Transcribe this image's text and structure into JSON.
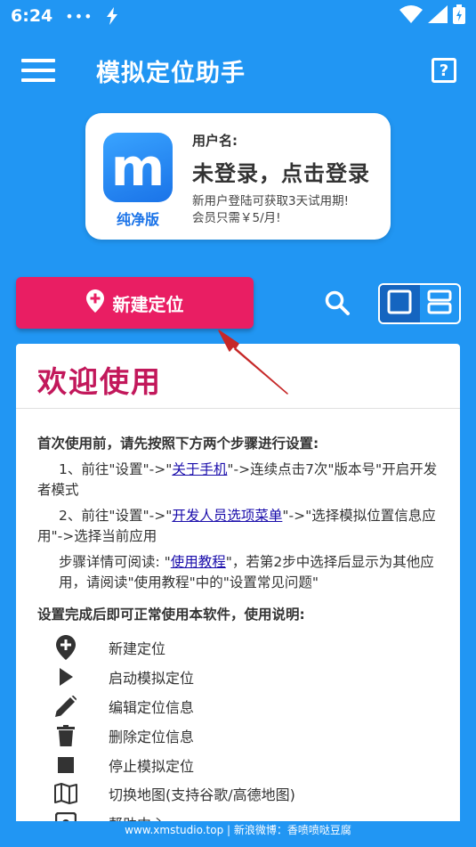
{
  "status_bar": {
    "time": "6:24",
    "dots": "•••"
  },
  "app_bar": {
    "title": "模拟定位助手",
    "help_glyph": "?"
  },
  "user_card": {
    "logo_glyph": "m",
    "logo_tag": "纯净版",
    "username_label": "用户名:",
    "login_text": "未登录，点击登录",
    "trial_line1": "新用户登陆可获取3天试用期!",
    "trial_line2": "会员只需￥5/月!"
  },
  "actions": {
    "new_location_label": "新建定位",
    "view_mode_selected": "grid"
  },
  "welcome": {
    "title": "欢迎使用",
    "intro": "首次使用前，请先按照下方两个步骤进行设置:",
    "step1_pre": "1、前往\"设置\"->\"",
    "step1_link": "关于手机",
    "step1_post": "\"->连续点击7次\"版本号\"开启开发者模式",
    "step2_pre": "2、前往\"设置\"->\"",
    "step2_link": "开发人员选项菜单",
    "step2_post": "\"->\"选择模拟位置信息应用\"->选择当前应用",
    "note_pre": "步骤详情可阅读: \"",
    "note_link": "使用教程",
    "note_post": "\"，若第2步中选择后显示为其他应用，请阅读\"使用教程\"中的\"设置常见问题\"",
    "usage_title": "设置完成后即可正常使用本软件，使用说明:",
    "usage_items": [
      {
        "icon": "add-location-icon",
        "label": "新建定位"
      },
      {
        "icon": "play-icon",
        "label": "启动模拟定位"
      },
      {
        "icon": "pencil-icon",
        "label": "编辑定位信息"
      },
      {
        "icon": "trash-icon",
        "label": "删除定位信息"
      },
      {
        "icon": "stop-icon",
        "label": "停止模拟定位"
      },
      {
        "icon": "map-icon",
        "label": "切换地图(支持谷歌/高德地图)"
      },
      {
        "icon": "help-center-icon",
        "label": "帮助中心"
      }
    ]
  },
  "footer": {
    "text": "www.xmstudio.top | 新浪微博：香喷喷哒豆腐"
  },
  "colors": {
    "background": "#2196F3",
    "accent_button": "#E91E63",
    "welcome_title": "#C2185B",
    "arrow": "#C62828"
  }
}
